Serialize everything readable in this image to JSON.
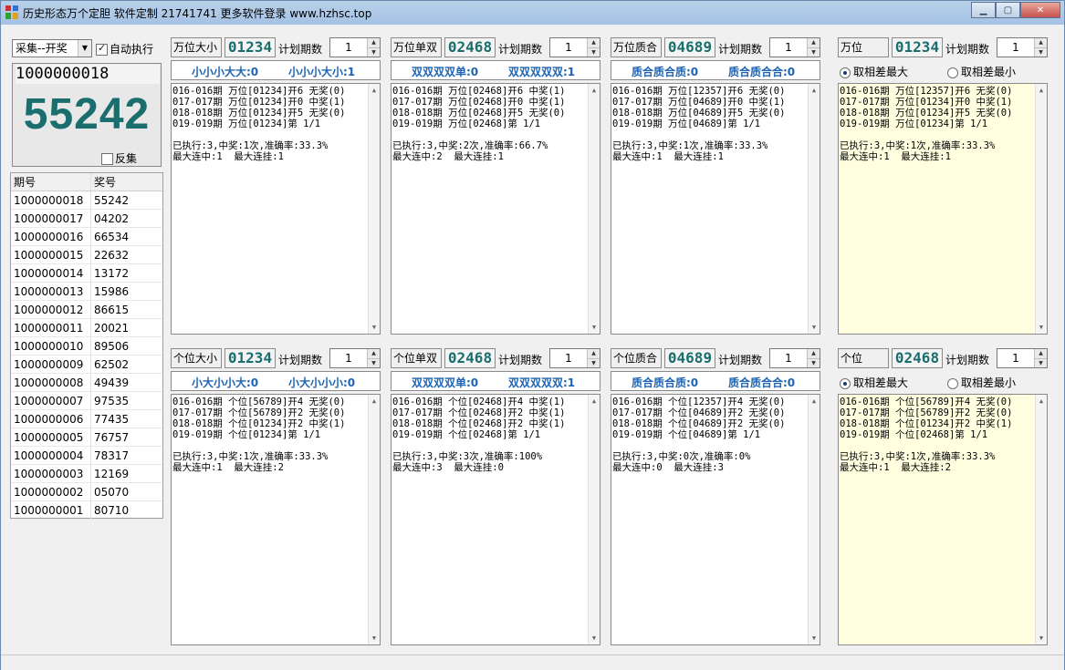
{
  "window": {
    "title": "历史形态万个定胆 软件定制 21741741 更多软件登录 www.hzhsc.top",
    "min_label": "▁",
    "max_label": "▢",
    "close_label": "✕"
  },
  "left": {
    "combo_value": "采集--开奖",
    "combo_arrow": "▼",
    "auto_exec_label": "自动执行",
    "current_issue": "1000000018",
    "current_number": "55242",
    "reverse_label": "反集",
    "history_headers": [
      "期号",
      "奖号"
    ],
    "history": [
      [
        "1000000018",
        "55242"
      ],
      [
        "1000000017",
        "04202"
      ],
      [
        "1000000016",
        "66534"
      ],
      [
        "1000000015",
        "22632"
      ],
      [
        "1000000014",
        "13172"
      ],
      [
        "1000000013",
        "15986"
      ],
      [
        "1000000012",
        "86615"
      ],
      [
        "1000000011",
        "20021"
      ],
      [
        "1000000010",
        "89506"
      ],
      [
        "1000000009",
        "62502"
      ],
      [
        "1000000008",
        "49439"
      ],
      [
        "1000000007",
        "97535"
      ],
      [
        "1000000006",
        "77435"
      ],
      [
        "1000000005",
        "76757"
      ],
      [
        "1000000004",
        "78317"
      ],
      [
        "1000000003",
        "12169"
      ],
      [
        "1000000002",
        "05070"
      ],
      [
        "1000000001",
        "80710"
      ]
    ]
  },
  "panels": [
    {
      "title": "万位大小",
      "number": "01234",
      "plan_label": "计划期数",
      "plan_value": "1",
      "bar_left": "小小小大大:0",
      "bar_right": "小小小大小:1",
      "lines": [
        "016-016期 万位[01234]开6 无奖(0)",
        "017-017期 万位[01234]开0 中奖(1)",
        "018-018期 万位[01234]开5 无奖(0)",
        "019-019期 万位[01234]第 1/1",
        "",
        "已执行:3,中奖:1次,准确率:33.3%",
        "最大连中:1  最大连挂:1"
      ]
    },
    {
      "title": "万位单双",
      "number": "02468",
      "plan_label": "计划期数",
      "plan_value": "1",
      "bar_left": "双双双双单:0",
      "bar_right": "双双双双双:1",
      "lines": [
        "016-016期 万位[02468]开6 中奖(1)",
        "017-017期 万位[02468]开0 中奖(1)",
        "018-018期 万位[02468]开5 无奖(0)",
        "019-019期 万位[02468]第 1/1",
        "",
        "已执行:3,中奖:2次,准确率:66.7%",
        "最大连中:2  最大连挂:1"
      ]
    },
    {
      "title": "万位质合",
      "number": "04689",
      "plan_label": "计划期数",
      "plan_value": "1",
      "bar_left": "质合质合质:0",
      "bar_right": "质合质合合:0",
      "lines": [
        "016-016期 万位[12357]开6 无奖(0)",
        "017-017期 万位[04689]开0 中奖(1)",
        "018-018期 万位[04689]开5 无奖(0)",
        "019-019期 万位[04689]第 1/1",
        "",
        "已执行:3,中奖:1次,准确率:33.3%",
        "最大连中:1  最大连挂:1"
      ]
    },
    {
      "title": "万位",
      "number": "01234",
      "plan_label": "计划期数",
      "plan_value": "1",
      "radio_a": "取相差最大",
      "radio_b": "取相差最小",
      "lines": [
        "016-016期 万位[12357]开6 无奖(0)",
        "017-017期 万位[01234]开0 中奖(1)",
        "018-018期 万位[01234]开5 无奖(0)",
        "019-019期 万位[01234]第 1/1",
        "",
        "已执行:3,中奖:1次,准确率:33.3%",
        "最大连中:1  最大连挂:1"
      ]
    },
    {
      "title": "个位大小",
      "number": "01234",
      "plan_label": "计划期数",
      "plan_value": "1",
      "bar_left": "小大小小大:0",
      "bar_right": "小大小小小:0",
      "lines": [
        "016-016期 个位[56789]开4 无奖(0)",
        "017-017期 个位[56789]开2 无奖(0)",
        "018-018期 个位[01234]开2 中奖(1)",
        "019-019期 个位[01234]第 1/1",
        "",
        "已执行:3,中奖:1次,准确率:33.3%",
        "最大连中:1  最大连挂:2"
      ]
    },
    {
      "title": "个位单双",
      "number": "02468",
      "plan_label": "计划期数",
      "plan_value": "1",
      "bar_left": "双双双双单:0",
      "bar_right": "双双双双双:1",
      "lines": [
        "016-016期 个位[02468]开4 中奖(1)",
        "017-017期 个位[02468]开2 中奖(1)",
        "018-018期 个位[02468]开2 中奖(1)",
        "019-019期 个位[02468]第 1/1",
        "",
        "已执行:3,中奖:3次,准确率:100%",
        "最大连中:3  最大连挂:0"
      ]
    },
    {
      "title": "个位质合",
      "number": "04689",
      "plan_label": "计划期数",
      "plan_value": "1",
      "bar_left": "质合质合质:0",
      "bar_right": "质合质合合:0",
      "lines": [
        "016-016期 个位[12357]开4 无奖(0)",
        "017-017期 个位[04689]开2 无奖(0)",
        "018-018期 个位[04689]开2 无奖(0)",
        "019-019期 个位[04689]第 1/1",
        "",
        "已执行:3,中奖:0次,准确率:0%",
        "最大连中:0  最大连挂:3"
      ]
    },
    {
      "title": "个位",
      "number": "02468",
      "plan_label": "计划期数",
      "plan_value": "1",
      "radio_a": "取相差最大",
      "radio_b": "取相差最小",
      "lines": [
        "016-016期 个位[56789]开4 无奖(0)",
        "017-017期 个位[56789]开2 无奖(0)",
        "018-018期 个位[01234]开2 中奖(1)",
        "019-019期 个位[02468]第 1/1",
        "",
        "已执行:3,中奖:1次,准确率:33.3%",
        "最大连中:1  最大连挂:2"
      ]
    }
  ]
}
